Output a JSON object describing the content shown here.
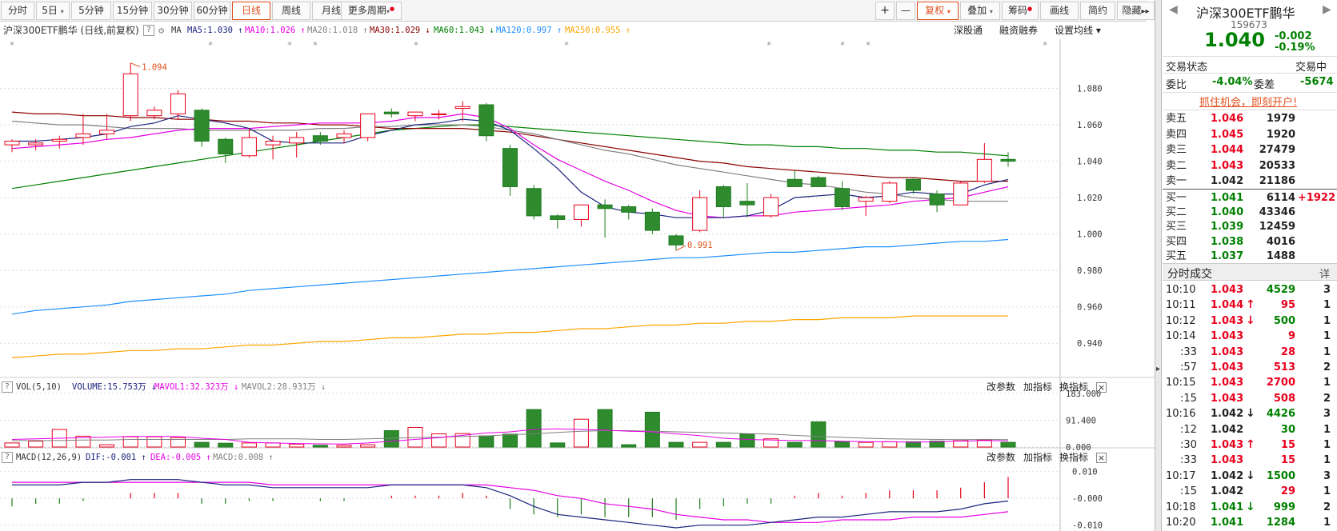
{
  "toolbar": {
    "periods": [
      "分时",
      "5日",
      "5分钟",
      "15分钟",
      "30分钟",
      "60分钟",
      "日线",
      "周线",
      "月线",
      "更多周期"
    ],
    "active": "日线",
    "right": [
      "+",
      "—",
      "复权",
      "叠加",
      "筹码",
      "画线",
      "简约",
      "隐藏"
    ],
    "arrows": "▸▸",
    "fq_label": "复权"
  },
  "legend": {
    "title": "沪深300ETF鹏华 (日线,前复权)",
    "ma_label": "MA",
    "ma5": "MA5:1.030",
    "ma10": "MA10:1.026",
    "ma20": "MA20:1.018",
    "ma30": "MA30:1.029",
    "ma60": "MA60:1.043",
    "ma120": "MA120:0.997",
    "ma250": "MA250:0.955",
    "links": [
      "深股通",
      "融资融券",
      "设置均线"
    ],
    "colors": {
      "ma5": "#1a237e",
      "ma10": "#e600e6",
      "ma20": "#808080",
      "ma30": "#8b0000",
      "ma60": "#008000",
      "ma120": "#1e90ff",
      "ma250": "#ffa500"
    }
  },
  "vol_header": {
    "name": "VOL(5,10)",
    "volume": "VOLUME:15.753万",
    "mavol1": "MAVOL1:32.323万",
    "mavol2": "MAVOL2:28.931万",
    "buttons": [
      "改参数",
      "加指标",
      "换指标"
    ]
  },
  "macd_header": {
    "name": "MACD(12,26,9)",
    "dif": "DIF:-0.001",
    "dea": "DEA:-0.005",
    "macd": "MACD:0.008",
    "buttons": [
      "改参数",
      "加指标",
      "换指标"
    ]
  },
  "chart_data": {
    "type": "candlestick",
    "ylim": [
      0.93,
      1.1
    ],
    "yticks": [
      "1.080",
      "1.060",
      "1.040",
      "1.020",
      "1.000",
      "0.980",
      "0.960",
      "0.940"
    ],
    "annotations": {
      "high": "1.094",
      "low": "0.991"
    },
    "candles": [
      {
        "o": 1.049,
        "h": 1.052,
        "l": 1.045,
        "c": 1.051
      },
      {
        "o": 1.049,
        "h": 1.052,
        "l": 1.046,
        "c": 1.05
      },
      {
        "o": 1.051,
        "h": 1.054,
        "l": 1.047,
        "c": 1.052
      },
      {
        "o": 1.053,
        "h": 1.066,
        "l": 1.049,
        "c": 1.055
      },
      {
        "o": 1.055,
        "h": 1.066,
        "l": 1.052,
        "c": 1.057
      },
      {
        "o": 1.065,
        "h": 1.094,
        "l": 1.062,
        "c": 1.088
      },
      {
        "o": 1.065,
        "h": 1.07,
        "l": 1.063,
        "c": 1.068
      },
      {
        "o": 1.066,
        "h": 1.079,
        "l": 1.063,
        "c": 1.077
      },
      {
        "o": 1.068,
        "h": 1.069,
        "l": 1.048,
        "c": 1.051
      },
      {
        "o": 1.052,
        "h": 1.053,
        "l": 1.039,
        "c": 1.044
      },
      {
        "o": 1.043,
        "h": 1.058,
        "l": 1.042,
        "c": 1.053
      },
      {
        "o": 1.049,
        "h": 1.054,
        "l": 1.041,
        "c": 1.051
      },
      {
        "o": 1.05,
        "h": 1.056,
        "l": 1.042,
        "c": 1.053
      },
      {
        "o": 1.054,
        "h": 1.056,
        "l": 1.049,
        "c": 1.051
      },
      {
        "o": 1.053,
        "h": 1.057,
        "l": 1.05,
        "c": 1.055
      },
      {
        "o": 1.053,
        "h": 1.059,
        "l": 1.051,
        "c": 1.066
      },
      {
        "o": 1.067,
        "h": 1.069,
        "l": 1.064,
        "c": 1.066
      },
      {
        "o": 1.065,
        "h": 1.067,
        "l": 1.062,
        "c": 1.067
      },
      {
        "o": 1.066,
        "h": 1.068,
        "l": 1.063,
        "c": 1.066
      },
      {
        "o": 1.069,
        "h": 1.073,
        "l": 1.062,
        "c": 1.07
      },
      {
        "o": 1.071,
        "h": 1.072,
        "l": 1.051,
        "c": 1.054
      },
      {
        "o": 1.047,
        "h": 1.049,
        "l": 1.021,
        "c": 1.026
      },
      {
        "o": 1.025,
        "h": 1.027,
        "l": 1.008,
        "c": 1.01
      },
      {
        "o": 1.01,
        "h": 1.011,
        "l": 1.003,
        "c": 1.008
      },
      {
        "o": 1.008,
        "h": 1.015,
        "l": 1.004,
        "c": 1.016
      },
      {
        "o": 1.016,
        "h": 1.019,
        "l": 0.998,
        "c": 1.014
      },
      {
        "o": 1.015,
        "h": 1.016,
        "l": 1.008,
        "c": 1.012
      },
      {
        "o": 1.012,
        "h": 1.014,
        "l": 1.0,
        "c": 1.002
      },
      {
        "o": 0.999,
        "h": 1.0,
        "l": 0.991,
        "c": 0.994
      },
      {
        "o": 1.002,
        "h": 1.024,
        "l": 1.001,
        "c": 1.02
      },
      {
        "o": 1.026,
        "h": 1.027,
        "l": 1.009,
        "c": 1.015
      },
      {
        "o": 1.018,
        "h": 1.028,
        "l": 1.009,
        "c": 1.016
      },
      {
        "o": 1.01,
        "h": 1.022,
        "l": 1.009,
        "c": 1.02
      },
      {
        "o": 1.03,
        "h": 1.035,
        "l": 1.026,
        "c": 1.026
      },
      {
        "o": 1.031,
        "h": 1.032,
        "l": 1.026,
        "c": 1.026
      },
      {
        "o": 1.025,
        "h": 1.029,
        "l": 1.013,
        "c": 1.015
      },
      {
        "o": 1.018,
        "h": 1.021,
        "l": 1.01,
        "c": 1.02
      },
      {
        "o": 1.018,
        "h": 1.029,
        "l": 1.017,
        "c": 1.028
      },
      {
        "o": 1.03,
        "h": 1.031,
        "l": 1.022,
        "c": 1.024
      },
      {
        "o": 1.022,
        "h": 1.024,
        "l": 1.012,
        "c": 1.016
      },
      {
        "o": 1.016,
        "h": 1.029,
        "l": 1.016,
        "c": 1.028
      },
      {
        "o": 1.029,
        "h": 1.05,
        "l": 1.028,
        "c": 1.041
      },
      {
        "o": 1.041,
        "h": 1.045,
        "l": 1.037,
        "c": 1.04
      }
    ],
    "ma5": [
      1.051,
      1.051,
      1.052,
      1.053,
      1.055,
      1.059,
      1.061,
      1.065,
      1.063,
      1.061,
      1.058,
      1.051,
      1.05,
      1.05,
      1.05,
      1.054,
      1.057,
      1.06,
      1.061,
      1.063,
      1.062,
      1.057,
      1.047,
      1.036,
      1.023,
      1.015,
      1.012,
      1.011,
      1.009,
      1.009,
      1.009,
      1.01,
      1.013,
      1.02,
      1.021,
      1.022,
      1.02,
      1.021,
      1.023,
      1.022,
      1.022,
      1.027,
      1.03
    ],
    "ma10": [
      1.047,
      1.048,
      1.049,
      1.05,
      1.052,
      1.053,
      1.055,
      1.057,
      1.058,
      1.058,
      1.058,
      1.059,
      1.06,
      1.061,
      1.061,
      1.061,
      1.062,
      1.064,
      1.064,
      1.066,
      1.064,
      1.058,
      1.049,
      1.041,
      1.035,
      1.029,
      1.024,
      1.018,
      1.013,
      1.01,
      1.009,
      1.01,
      1.01,
      1.012,
      1.013,
      1.014,
      1.015,
      1.016,
      1.018,
      1.019,
      1.02,
      1.023,
      1.026
    ],
    "ma20": [
      1.062,
      1.061,
      1.06,
      1.06,
      1.059,
      1.058,
      1.058,
      1.058,
      1.057,
      1.057,
      1.057,
      1.057,
      1.057,
      1.058,
      1.058,
      1.059,
      1.059,
      1.06,
      1.06,
      1.06,
      1.059,
      1.057,
      1.055,
      1.052,
      1.049,
      1.046,
      1.044,
      1.041,
      1.038,
      1.036,
      1.034,
      1.032,
      1.03,
      1.028,
      1.027,
      1.025,
      1.023,
      1.022,
      1.02,
      1.019,
      1.018,
      1.018,
      1.018
    ],
    "ma30": [
      1.067,
      1.066,
      1.066,
      1.065,
      1.065,
      1.064,
      1.064,
      1.063,
      1.063,
      1.062,
      1.062,
      1.061,
      1.061,
      1.06,
      1.06,
      1.059,
      1.058,
      1.058,
      1.058,
      1.058,
      1.057,
      1.056,
      1.054,
      1.052,
      1.05,
      1.048,
      1.046,
      1.044,
      1.042,
      1.04,
      1.039,
      1.037,
      1.036,
      1.035,
      1.034,
      1.033,
      1.032,
      1.031,
      1.031,
      1.03,
      1.029,
      1.029,
      1.029
    ],
    "ma60": [
      1.025,
      1.027,
      1.029,
      1.031,
      1.033,
      1.035,
      1.037,
      1.039,
      1.041,
      1.043,
      1.045,
      1.047,
      1.049,
      1.051,
      1.053,
      1.055,
      1.057,
      1.058,
      1.059,
      1.06,
      1.06,
      1.059,
      1.058,
      1.057,
      1.056,
      1.055,
      1.054,
      1.053,
      1.052,
      1.051,
      1.05,
      1.049,
      1.049,
      1.048,
      1.048,
      1.047,
      1.047,
      1.046,
      1.046,
      1.045,
      1.045,
      1.044,
      1.043
    ],
    "ma120": [
      0.956,
      0.958,
      0.959,
      0.96,
      0.961,
      0.963,
      0.964,
      0.965,
      0.966,
      0.967,
      0.969,
      0.97,
      0.971,
      0.972,
      0.973,
      0.974,
      0.975,
      0.976,
      0.977,
      0.978,
      0.979,
      0.98,
      0.981,
      0.982,
      0.983,
      0.984,
      0.985,
      0.986,
      0.987,
      0.987,
      0.988,
      0.989,
      0.99,
      0.99,
      0.991,
      0.992,
      0.993,
      0.993,
      0.994,
      0.995,
      0.996,
      0.996,
      0.997
    ],
    "ma250": [
      0.932,
      0.933,
      0.934,
      0.934,
      0.935,
      0.936,
      0.936,
      0.937,
      0.937,
      0.938,
      0.939,
      0.939,
      0.94,
      0.941,
      0.941,
      0.942,
      0.943,
      0.943,
      0.944,
      0.945,
      0.945,
      0.946,
      0.946,
      0.947,
      0.948,
      0.948,
      0.949,
      0.95,
      0.95,
      0.951,
      0.951,
      0.952,
      0.952,
      0.953,
      0.953,
      0.954,
      0.954,
      0.954,
      0.955,
      0.955,
      0.955,
      0.955,
      0.955
    ],
    "vol": {
      "ylim": [
        0,
        183
      ],
      "yticks": [
        "183.000",
        "91.400",
        "0.000"
      ],
      "values": [
        14,
        20,
        60,
        37,
        8,
        35,
        35,
        32,
        16,
        13,
        14,
        14,
        10,
        6,
        6,
        8,
        56,
        67,
        45,
        46,
        38,
        44,
        128,
        14,
        95,
        128,
        8,
        119,
        16,
        16,
        16,
        44,
        28,
        16,
        86,
        18,
        16,
        18,
        18,
        20,
        24,
        24,
        16
      ],
      "mavol1": [
        26,
        28,
        30,
        32,
        34,
        36,
        36,
        36,
        30,
        26,
        16,
        14,
        12,
        11,
        10,
        14,
        20,
        26,
        32,
        40,
        48,
        52,
        60,
        62,
        60,
        58,
        54,
        52,
        45,
        39,
        30,
        26,
        24,
        22,
        22,
        20,
        18,
        18,
        16,
        18,
        20,
        22,
        21
      ],
      "mavol2": [
        22,
        22,
        22,
        24,
        24,
        26,
        26,
        26,
        26,
        26,
        28,
        28,
        28,
        26,
        26,
        28,
        30,
        32,
        34,
        36,
        38,
        42,
        45,
        50,
        54,
        56,
        56,
        54,
        52,
        50,
        48,
        46,
        44,
        40,
        36,
        33,
        30,
        28,
        27,
        26,
        25,
        26,
        25
      ]
    },
    "macd": {
      "ylim": [
        -0.011,
        0.012
      ],
      "yticks": [
        "0.010",
        "-0.000",
        "-0.010"
      ],
      "bars": [
        -0.003,
        -0.002,
        -0.002,
        -0.001,
        0.0,
        0.002,
        0.002,
        0.002,
        -0.002,
        -0.002,
        -0.001,
        -0.001,
        0.0,
        -0.001,
        -0.001,
        0.0,
        0.001,
        0.001,
        0.001,
        0.002,
        0.001,
        -0.004,
        -0.006,
        -0.007,
        -0.006,
        -0.007,
        -0.007,
        -0.007,
        -0.008,
        -0.004,
        -0.003,
        -0.002,
        -0.002,
        0.001,
        0.002,
        0.001,
        0.002,
        0.003,
        0.003,
        0.003,
        0.004,
        0.006,
        0.008
      ],
      "dif": [
        0.005,
        0.005,
        0.005,
        0.006,
        0.006,
        0.007,
        0.007,
        0.007,
        0.006,
        0.005,
        0.005,
        0.004,
        0.004,
        0.004,
        0.004,
        0.004,
        0.005,
        0.005,
        0.005,
        0.005,
        0.004,
        0.001,
        -0.003,
        -0.006,
        -0.007,
        -0.008,
        -0.009,
        -0.01,
        -0.011,
        -0.01,
        -0.01,
        -0.01,
        -0.009,
        -0.008,
        -0.007,
        -0.007,
        -0.006,
        -0.005,
        -0.005,
        -0.005,
        -0.004,
        -0.002,
        -0.001
      ],
      "dea": [
        0.006,
        0.006,
        0.006,
        0.006,
        0.006,
        0.006,
        0.006,
        0.006,
        0.006,
        0.006,
        0.006,
        0.005,
        0.005,
        0.005,
        0.005,
        0.005,
        0.005,
        0.005,
        0.005,
        0.005,
        0.005,
        0.004,
        0.003,
        0.001,
        0.0,
        -0.002,
        -0.003,
        -0.004,
        -0.006,
        -0.007,
        -0.008,
        -0.008,
        -0.009,
        -0.009,
        -0.009,
        -0.008,
        -0.008,
        -0.008,
        -0.007,
        -0.007,
        -0.007,
        -0.006,
        -0.005
      ]
    }
  },
  "side": {
    "name": "沪深300ETF鹏华",
    "code": "159673",
    "price": "1.040",
    "change": "-0.002",
    "change_pct": "-0.19%",
    "status_label": "交易状态",
    "status_value": "交易中",
    "wb_label": "委比",
    "wb_value": "-4.04%",
    "wc_label": "委差",
    "wc_value": "-5674",
    "promo": "抓住机会，即刻开户!",
    "asks": [
      {
        "label": "卖五",
        "price": "1.046",
        "vol": "1979",
        "pc": "r"
      },
      {
        "label": "卖四",
        "price": "1.045",
        "vol": "1920",
        "pc": "r"
      },
      {
        "label": "卖三",
        "price": "1.044",
        "vol": "27479",
        "pc": "r"
      },
      {
        "label": "卖二",
        "price": "1.043",
        "vol": "20533",
        "pc": "r"
      },
      {
        "label": "卖一",
        "price": "1.042",
        "vol": "21186",
        "pc": "k"
      }
    ],
    "bids": [
      {
        "label": "买一",
        "price": "1.041",
        "vol": "6114",
        "extra": "+1922",
        "pc": "g"
      },
      {
        "label": "买二",
        "price": "1.040",
        "vol": "43346",
        "extra": "",
        "pc": "g"
      },
      {
        "label": "买三",
        "price": "1.039",
        "vol": "12459",
        "extra": "",
        "pc": "g"
      },
      {
        "label": "买四",
        "price": "1.038",
        "vol": "4016",
        "extra": "",
        "pc": "g"
      },
      {
        "label": "买五",
        "price": "1.037",
        "vol": "1488",
        "extra": "",
        "pc": "g"
      }
    ],
    "trades_title": "分时成交",
    "trades_detail": "详",
    "trades": [
      {
        "time": "10:10",
        "price": "1.043",
        "arrow": "",
        "vol": "4529",
        "n": "3",
        "pc": "r",
        "vc": "g"
      },
      {
        "time": "10:11",
        "price": "1.044",
        "arrow": "↑",
        "vol": "95",
        "n": "1",
        "pc": "r",
        "vc": "r"
      },
      {
        "time": "10:12",
        "price": "1.043",
        "arrow": "↓",
        "vol": "500",
        "n": "1",
        "pc": "r",
        "vc": "g"
      },
      {
        "time": "10:14",
        "price": "1.043",
        "arrow": "",
        "vol": "9",
        "n": "1",
        "pc": "r",
        "vc": "r"
      },
      {
        "time": ":33",
        "price": "1.043",
        "arrow": "",
        "vol": "28",
        "n": "1",
        "pc": "r",
        "vc": "r"
      },
      {
        "time": ":57",
        "price": "1.043",
        "arrow": "",
        "vol": "513",
        "n": "2",
        "pc": "r",
        "vc": "r"
      },
      {
        "time": "10:15",
        "price": "1.043",
        "arrow": "",
        "vol": "2700",
        "n": "1",
        "pc": "r",
        "vc": "r"
      },
      {
        "time": ":15",
        "price": "1.043",
        "arrow": "",
        "vol": "508",
        "n": "2",
        "pc": "r",
        "vc": "r"
      },
      {
        "time": "10:16",
        "price": "1.042",
        "arrow": "↓",
        "vol": "4426",
        "n": "3",
        "pc": "k",
        "vc": "g"
      },
      {
        "time": ":12",
        "price": "1.042",
        "arrow": "",
        "vol": "30",
        "n": "1",
        "pc": "k",
        "vc": "g"
      },
      {
        "time": ":30",
        "price": "1.043",
        "arrow": "↑",
        "vol": "15",
        "n": "1",
        "pc": "r",
        "vc": "r"
      },
      {
        "time": ":33",
        "price": "1.043",
        "arrow": "",
        "vol": "15",
        "n": "1",
        "pc": "r",
        "vc": "r"
      },
      {
        "time": "10:17",
        "price": "1.042",
        "arrow": "↓",
        "vol": "1500",
        "n": "3",
        "pc": "k",
        "vc": "g"
      },
      {
        "time": ":15",
        "price": "1.042",
        "arrow": "",
        "vol": "29",
        "n": "1",
        "pc": "k",
        "vc": "r"
      },
      {
        "time": "10:18",
        "price": "1.041",
        "arrow": "↓",
        "vol": "999",
        "n": "2",
        "pc": "g",
        "vc": "g"
      },
      {
        "time": "10:20",
        "price": "1.041",
        "arrow": "",
        "vol": "1284",
        "n": "1",
        "pc": "g",
        "vc": "g"
      }
    ]
  }
}
